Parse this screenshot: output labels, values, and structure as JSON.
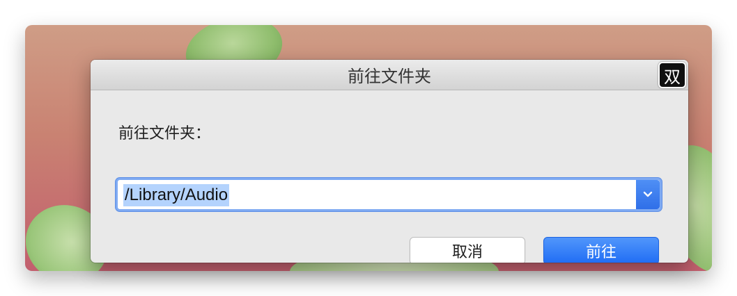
{
  "dialog": {
    "title": "前往文件夹",
    "ime_indicator": "双",
    "field_label": "前往文件夹：",
    "path_value": "/Library/Audio",
    "cancel_label": "取消",
    "go_label": "前往"
  },
  "colors": {
    "accent": "#2f6fe8",
    "selection": "#b4d3fd",
    "focus_ring": "#7faaf2"
  },
  "icons": {
    "dropdown": "chevron-down-icon"
  }
}
